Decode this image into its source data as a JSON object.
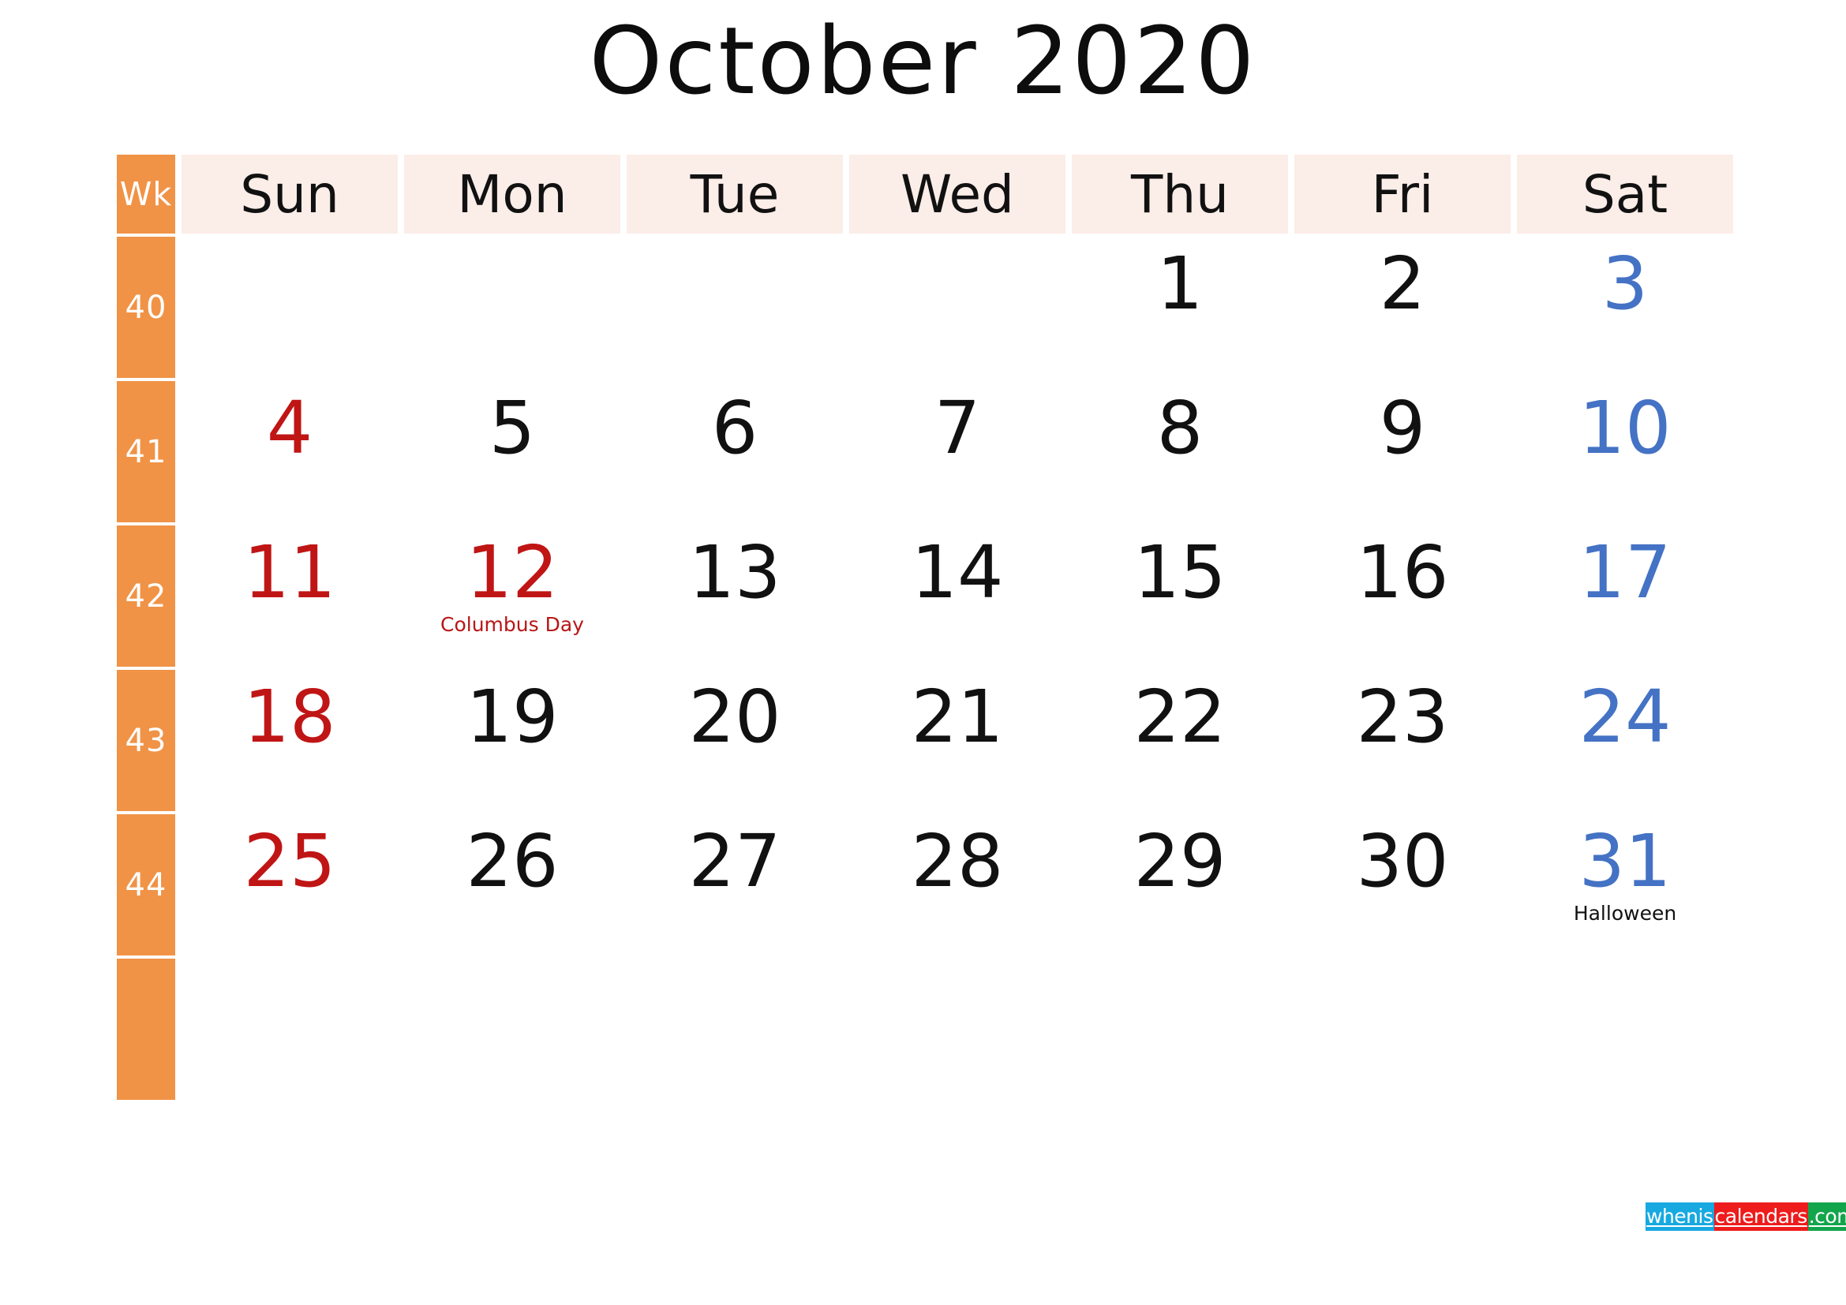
{
  "title": "October 2020",
  "colors": {
    "week_column_bg": "#F09346",
    "header_day_bg": "#FBEDE8",
    "sunday_text": "#C01515",
    "saturday_text": "#4472C4",
    "weekday_text": "#111111",
    "page_bg": "#FFFFFF"
  },
  "header": {
    "week_label": "Wk",
    "days": [
      "Sun",
      "Mon",
      "Tue",
      "Wed",
      "Thu",
      "Fri",
      "Sat"
    ]
  },
  "weeks": [
    {
      "week_number": "40",
      "days": [
        {
          "num": "",
          "note": "",
          "kind": "sun"
        },
        {
          "num": "",
          "note": "",
          "kind": "weekday"
        },
        {
          "num": "",
          "note": "",
          "kind": "weekday"
        },
        {
          "num": "",
          "note": "",
          "kind": "weekday"
        },
        {
          "num": "1",
          "note": "",
          "kind": "weekday"
        },
        {
          "num": "2",
          "note": "",
          "kind": "weekday"
        },
        {
          "num": "3",
          "note": "",
          "kind": "sat"
        }
      ]
    },
    {
      "week_number": "41",
      "days": [
        {
          "num": "4",
          "note": "",
          "kind": "sun"
        },
        {
          "num": "5",
          "note": "",
          "kind": "weekday"
        },
        {
          "num": "6",
          "note": "",
          "kind": "weekday"
        },
        {
          "num": "7",
          "note": "",
          "kind": "weekday"
        },
        {
          "num": "8",
          "note": "",
          "kind": "weekday"
        },
        {
          "num": "9",
          "note": "",
          "kind": "weekday"
        },
        {
          "num": "10",
          "note": "",
          "kind": "sat"
        }
      ]
    },
    {
      "week_number": "42",
      "days": [
        {
          "num": "11",
          "note": "",
          "kind": "sun"
        },
        {
          "num": "12",
          "note": "Columbus Day",
          "note_color": "red",
          "kind": "sun"
        },
        {
          "num": "13",
          "note": "",
          "kind": "weekday"
        },
        {
          "num": "14",
          "note": "",
          "kind": "weekday"
        },
        {
          "num": "15",
          "note": "",
          "kind": "weekday"
        },
        {
          "num": "16",
          "note": "",
          "kind": "weekday"
        },
        {
          "num": "17",
          "note": "",
          "kind": "sat"
        }
      ]
    },
    {
      "week_number": "43",
      "days": [
        {
          "num": "18",
          "note": "",
          "kind": "sun"
        },
        {
          "num": "19",
          "note": "",
          "kind": "weekday"
        },
        {
          "num": "20",
          "note": "",
          "kind": "weekday"
        },
        {
          "num": "21",
          "note": "",
          "kind": "weekday"
        },
        {
          "num": "22",
          "note": "",
          "kind": "weekday"
        },
        {
          "num": "23",
          "note": "",
          "kind": "weekday"
        },
        {
          "num": "24",
          "note": "",
          "kind": "sat"
        }
      ]
    },
    {
      "week_number": "44",
      "days": [
        {
          "num": "25",
          "note": "",
          "kind": "sun"
        },
        {
          "num": "26",
          "note": "",
          "kind": "weekday"
        },
        {
          "num": "27",
          "note": "",
          "kind": "weekday"
        },
        {
          "num": "28",
          "note": "",
          "kind": "weekday"
        },
        {
          "num": "29",
          "note": "",
          "kind": "weekday"
        },
        {
          "num": "30",
          "note": "",
          "kind": "weekday"
        },
        {
          "num": "31",
          "note": "Halloween",
          "note_color": "black",
          "kind": "sat"
        }
      ]
    },
    {
      "week_number": "",
      "days": [
        {
          "num": "",
          "note": "",
          "kind": "sun"
        },
        {
          "num": "",
          "note": "",
          "kind": "weekday"
        },
        {
          "num": "",
          "note": "",
          "kind": "weekday"
        },
        {
          "num": "",
          "note": "",
          "kind": "weekday"
        },
        {
          "num": "",
          "note": "",
          "kind": "weekday"
        },
        {
          "num": "",
          "note": "",
          "kind": "weekday"
        },
        {
          "num": "",
          "note": "",
          "kind": "sat"
        }
      ]
    }
  ],
  "watermark": {
    "segment_1": "whenis",
    "segment_2": "calendars",
    "segment_3": ".com"
  }
}
